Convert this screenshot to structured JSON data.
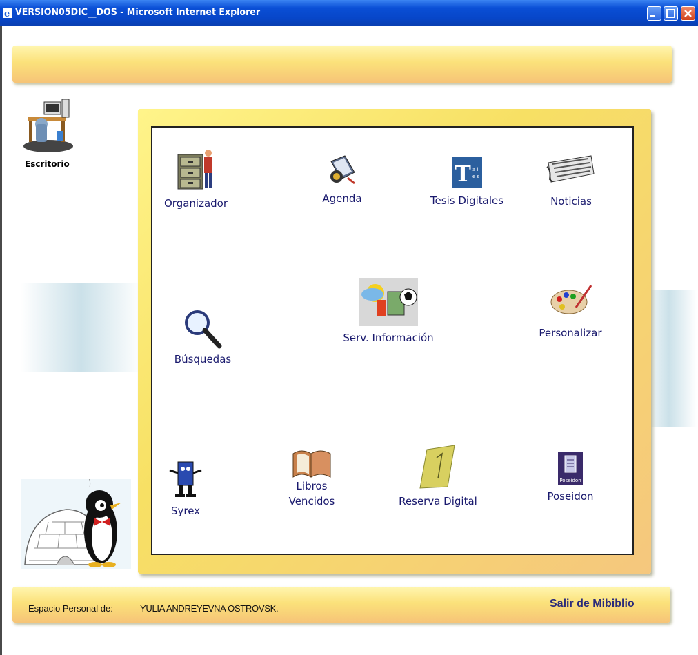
{
  "window": {
    "title": "VERSION05DIC__DOS - Microsoft Internet Explorer"
  },
  "sidebar": {
    "desktop_label": "Escritorio"
  },
  "apps": {
    "organizador": "Organizador",
    "agenda": "Agenda",
    "tesis": "Tesis Digitales",
    "noticias": "Noticias",
    "busquedas": "Búsquedas",
    "serv_info": "Serv. Información",
    "personalizar": "Personalizar",
    "syrex": "Syrex",
    "libros_1": "Libros",
    "libros_2": "Vencidos",
    "reserva": "Reserva Digital",
    "poseidon": "Poseidon"
  },
  "icon_text": {
    "tesis_letter": "T",
    "tesis_small": "a l e s",
    "poseidon_badge": "Poseidon"
  },
  "footer": {
    "label": "Espacio Personal de:",
    "user": "YULIA ANDREYEVNA OSTROVSK.",
    "exit": "Salir de Mibiblio"
  },
  "colors": {
    "titlebar": "#0a4fd6",
    "frame_yellow": "#f7e064",
    "label_text": "#1a1a6e",
    "exit_text": "#2a2a7a"
  }
}
